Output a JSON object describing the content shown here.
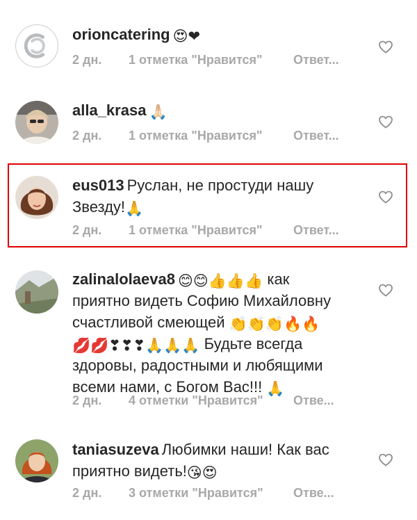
{
  "comments": [
    {
      "username": "orioncatering",
      "emoji": "😍❤",
      "text": "",
      "time": "2 дн.",
      "likes": "1 отметка \"Нравится\"",
      "reply": "Ответ..."
    },
    {
      "username": "alla_krasa",
      "emoji": "🙏🏻",
      "text": "",
      "time": "2 дн.",
      "likes": "1 отметка \"Нравится\"",
      "reply": "Ответ..."
    },
    {
      "username": "eus013",
      "text_line1": "Руслан, не простуди нашу",
      "text_line2": "Звезду!",
      "emoji": "🙏",
      "time": "2 дн.",
      "likes": "1 отметка \"Нравится\"",
      "reply": "Ответ..."
    },
    {
      "username": "zalinalolaeva8",
      "emoji1": "😊😊👍👍👍",
      "line1_text": "как",
      "line2": "приятно видеть Софию Михайловну",
      "line3_text": "счастливой смеющей",
      "emoji2": "👏👏👏🔥🔥",
      "emoji3": "💋💋❣❣❣🙏🙏🙏",
      "line4_text": "Будьте всегда",
      "line5": "здоровы, радостными и любящими",
      "line6_text": "всеми нами, с Богом Вас!!!",
      "emoji4": "🙏",
      "time": "2 дн.",
      "likes": "4 отметки \"Нравится\"",
      "reply": "Отве..."
    },
    {
      "username": "taniasuzeva",
      "text_line1": "Любимки наши! Как вас",
      "text_line2": "приятно видеть!",
      "emoji": "😘😍",
      "time": "2 дн.",
      "likes": "3 отметки \"Нравится\"",
      "reply": "Отве..."
    }
  ],
  "icons": {
    "like": "heart-outline-icon"
  },
  "colors": {
    "text": "#262626",
    "meta": "#a8a8a8",
    "highlight_border": "#e00000"
  }
}
